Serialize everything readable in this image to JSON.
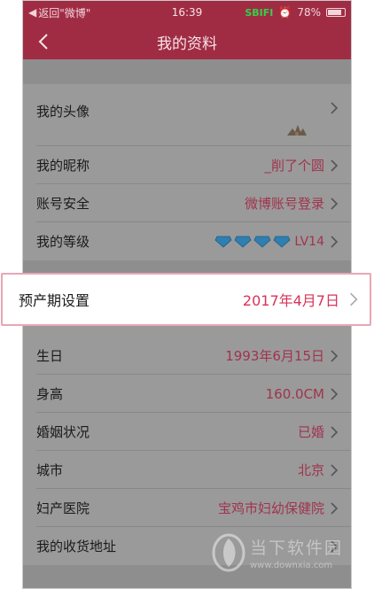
{
  "status_bar": {
    "back_app": "返回\"微博\"",
    "time": "16:39",
    "carrier": "SBIFI",
    "battery": "78%"
  },
  "nav": {
    "title": "我的资料"
  },
  "section1": [
    {
      "label": "我的头像",
      "value": ""
    },
    {
      "label": "我的昵称",
      "value": "_削了个圆"
    },
    {
      "label": "账号安全",
      "value": "微博账号登录"
    },
    {
      "label": "我的等级",
      "value": "LV14"
    }
  ],
  "highlight": {
    "label": "预产期设置",
    "value": "2017年4月7日"
  },
  "section2": [
    {
      "label": "生日",
      "value": "1993年6月15日"
    },
    {
      "label": "身高",
      "value": "160.0CM"
    },
    {
      "label": "婚姻状况",
      "value": "已婚"
    },
    {
      "label": "城市",
      "value": "北京"
    },
    {
      "label": "妇产医院",
      "value": "宝鸡市妇幼保健院"
    },
    {
      "label": "我的收货地址",
      "value": ""
    }
  ],
  "watermark": {
    "title": "当下软件园",
    "url": "www.downxia.com"
  },
  "colors": {
    "header": "#a02c44",
    "value": "#a0344d",
    "highlight_value": "#d7335a"
  }
}
